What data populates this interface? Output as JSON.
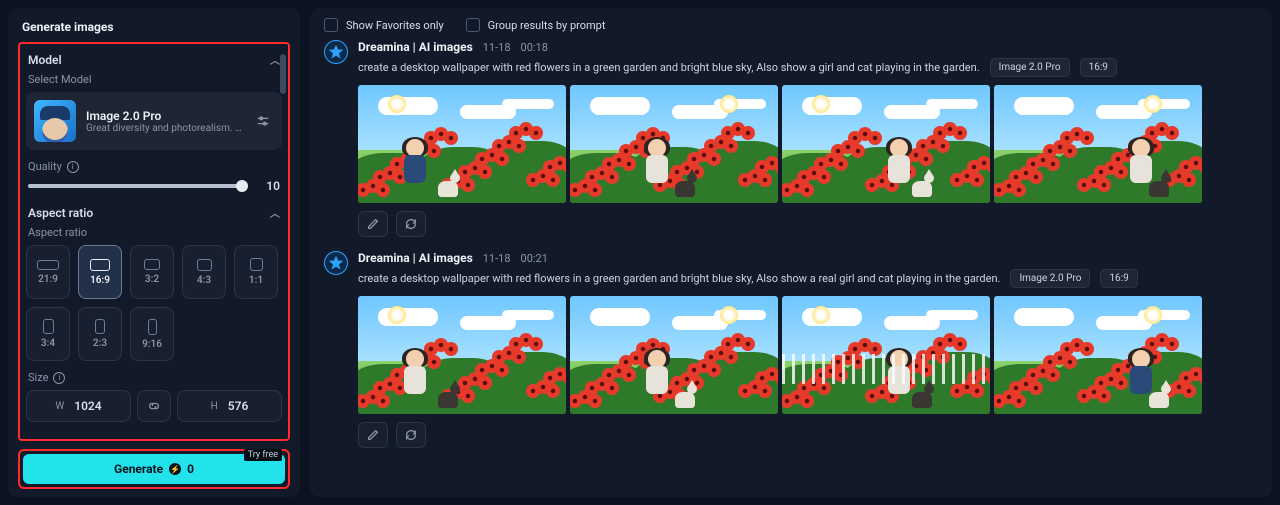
{
  "sidebar": {
    "title": "Generate images",
    "model_section": "Model",
    "select_model": "Select Model",
    "model": {
      "name": "Image 2.0 Pro",
      "desc": "Great diversity and photorealism. ..."
    },
    "quality_label": "Quality",
    "quality_value": "10",
    "aspect_section": "Aspect ratio",
    "aspect_label": "Aspect ratio",
    "aspects": [
      {
        "label": "21:9",
        "w": 22,
        "h": 10,
        "sel": false
      },
      {
        "label": "16:9",
        "w": 20,
        "h": 12,
        "sel": true
      },
      {
        "label": "3:2",
        "w": 16,
        "h": 11,
        "sel": false
      },
      {
        "label": "4:3",
        "w": 15,
        "h": 12,
        "sel": false
      },
      {
        "label": "1:1",
        "w": 13,
        "h": 13,
        "sel": false
      },
      {
        "label": "3:4",
        "w": 11,
        "h": 15,
        "sel": false
      },
      {
        "label": "2:3",
        "w": 10,
        "h": 15,
        "sel": false
      },
      {
        "label": "9:16",
        "w": 9,
        "h": 16,
        "sel": false
      }
    ],
    "size_label": "Size",
    "width": "1024",
    "height": "576",
    "generate": "Generate",
    "cost": "0",
    "tryfree": "Try free"
  },
  "filters": {
    "favorites": "Show Favorites only",
    "group": "Group results by prompt"
  },
  "posts": [
    {
      "author": "Dreamina | AI images",
      "date": "11-18",
      "time": "00:18",
      "prompt": "create a desktop wallpaper with red flowers in a green garden and bright blue sky, Also show a girl and cat playing in the garden.",
      "model": "Image 2.0 Pro",
      "aspect": "16:9"
    },
    {
      "author": "Dreamina | AI images",
      "date": "11-18",
      "time": "00:21",
      "prompt": "create a desktop wallpaper with red flowers in a green garden and bright blue sky, Also show a real girl and cat playing in the garden.",
      "model": "Image 2.0 Pro",
      "aspect": "16:9"
    }
  ]
}
